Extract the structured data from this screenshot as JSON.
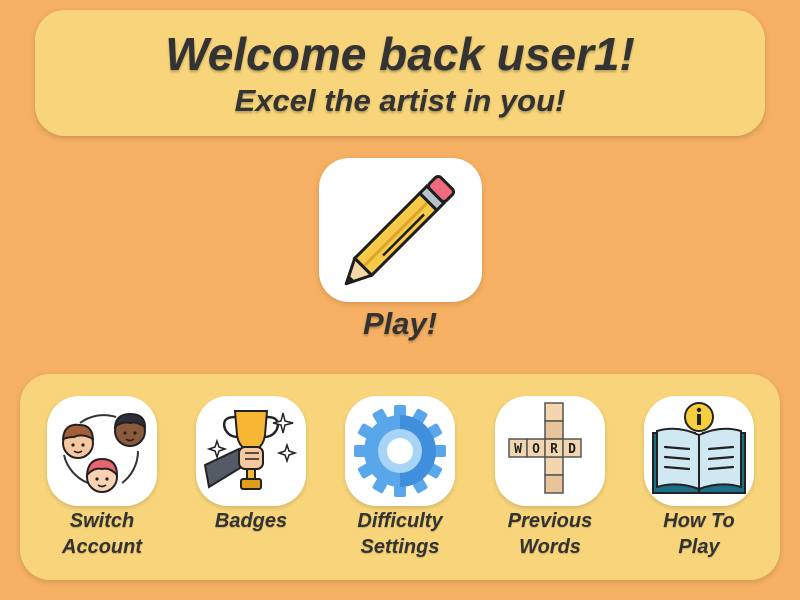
{
  "header": {
    "title": "Welcome back user1!",
    "subtitle": "Excel the artist in you!"
  },
  "play": {
    "label": "Play!",
    "icon": "pencil-icon"
  },
  "menu": {
    "items": [
      {
        "label": "Switch\nAccount",
        "icon": "users-icon"
      },
      {
        "label": "Badges",
        "icon": "trophy-icon"
      },
      {
        "label": "Difficulty\nSettings",
        "icon": "gear-icon"
      },
      {
        "label": "Previous\nWords",
        "icon": "crossword-icon"
      },
      {
        "label": "How To\nPlay",
        "icon": "info-book-icon"
      }
    ]
  },
  "colors": {
    "background": "#f6b063",
    "panel": "#f8d57a",
    "text": "#333333",
    "tile": "#ffffff"
  }
}
